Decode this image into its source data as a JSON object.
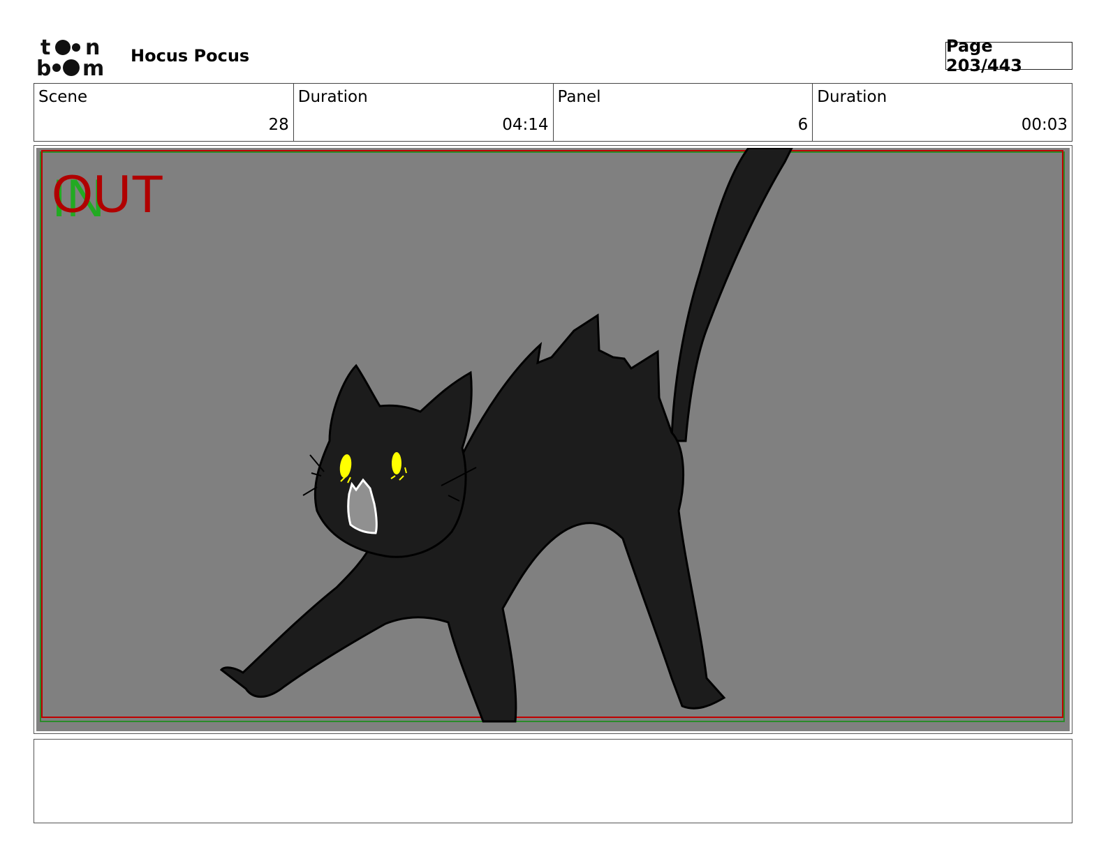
{
  "header": {
    "logo_text": "toonboom",
    "project_title": "Hocus Pocus",
    "page_label": "Page 203/443"
  },
  "info": {
    "scene_label": "Scene",
    "scene_value": "28",
    "scene_duration_label": "Duration",
    "scene_duration_value": "04:14",
    "panel_label": "Panel",
    "panel_value": "6",
    "panel_duration_label": "Duration",
    "panel_duration_value": "00:03"
  },
  "panel": {
    "in_marker": "IN",
    "out_marker": "OUT",
    "background_color": "#808080",
    "cat_color": "#1c1c1c",
    "eye_color": "#ffff00",
    "safe_frame_color": "#c00000",
    "in_marker_color": "#22aa22"
  },
  "notes": {
    "text": ""
  }
}
